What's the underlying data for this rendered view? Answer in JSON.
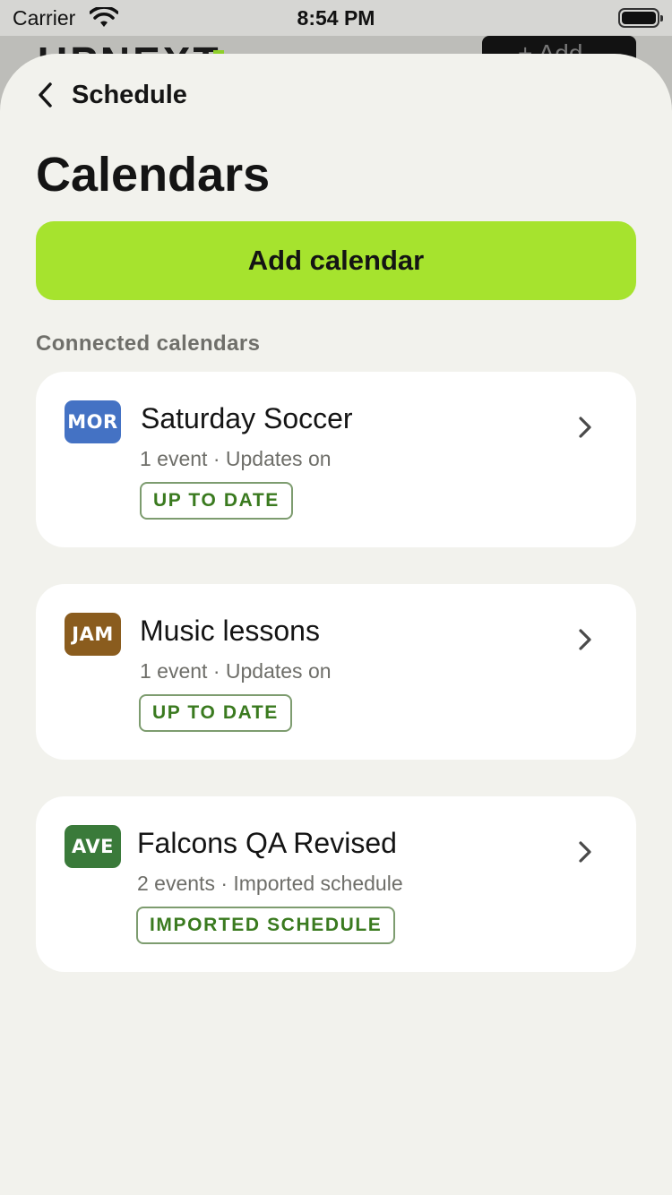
{
  "status_bar": {
    "carrier": "Carrier",
    "time": "8:54 PM"
  },
  "background_app": {
    "logo": "UPNEXT",
    "add_label": "+ Add"
  },
  "nav": {
    "back_label": "Schedule"
  },
  "page": {
    "title": "Calendars",
    "add_button_label": "Add calendar",
    "section_label": "Connected calendars"
  },
  "calendars": [
    {
      "badge": "MOR",
      "badge_color": "#4472c4",
      "title": "Saturday Soccer",
      "meta": "1 event · Updates on",
      "status": "UP TO DATE"
    },
    {
      "badge": "JAM",
      "badge_color": "#8a5c1e",
      "title": "Music lessons",
      "meta": "1 event · Updates on",
      "status": "UP TO DATE"
    },
    {
      "badge": "AVE",
      "badge_color": "#3a7a3a",
      "title": "Falcons QA Revised",
      "meta": "2 events · Imported schedule",
      "status": "IMPORTED SCHEDULE"
    }
  ],
  "colors": {
    "accent": "#a6e32e",
    "status_text": "#3a7a1f"
  }
}
